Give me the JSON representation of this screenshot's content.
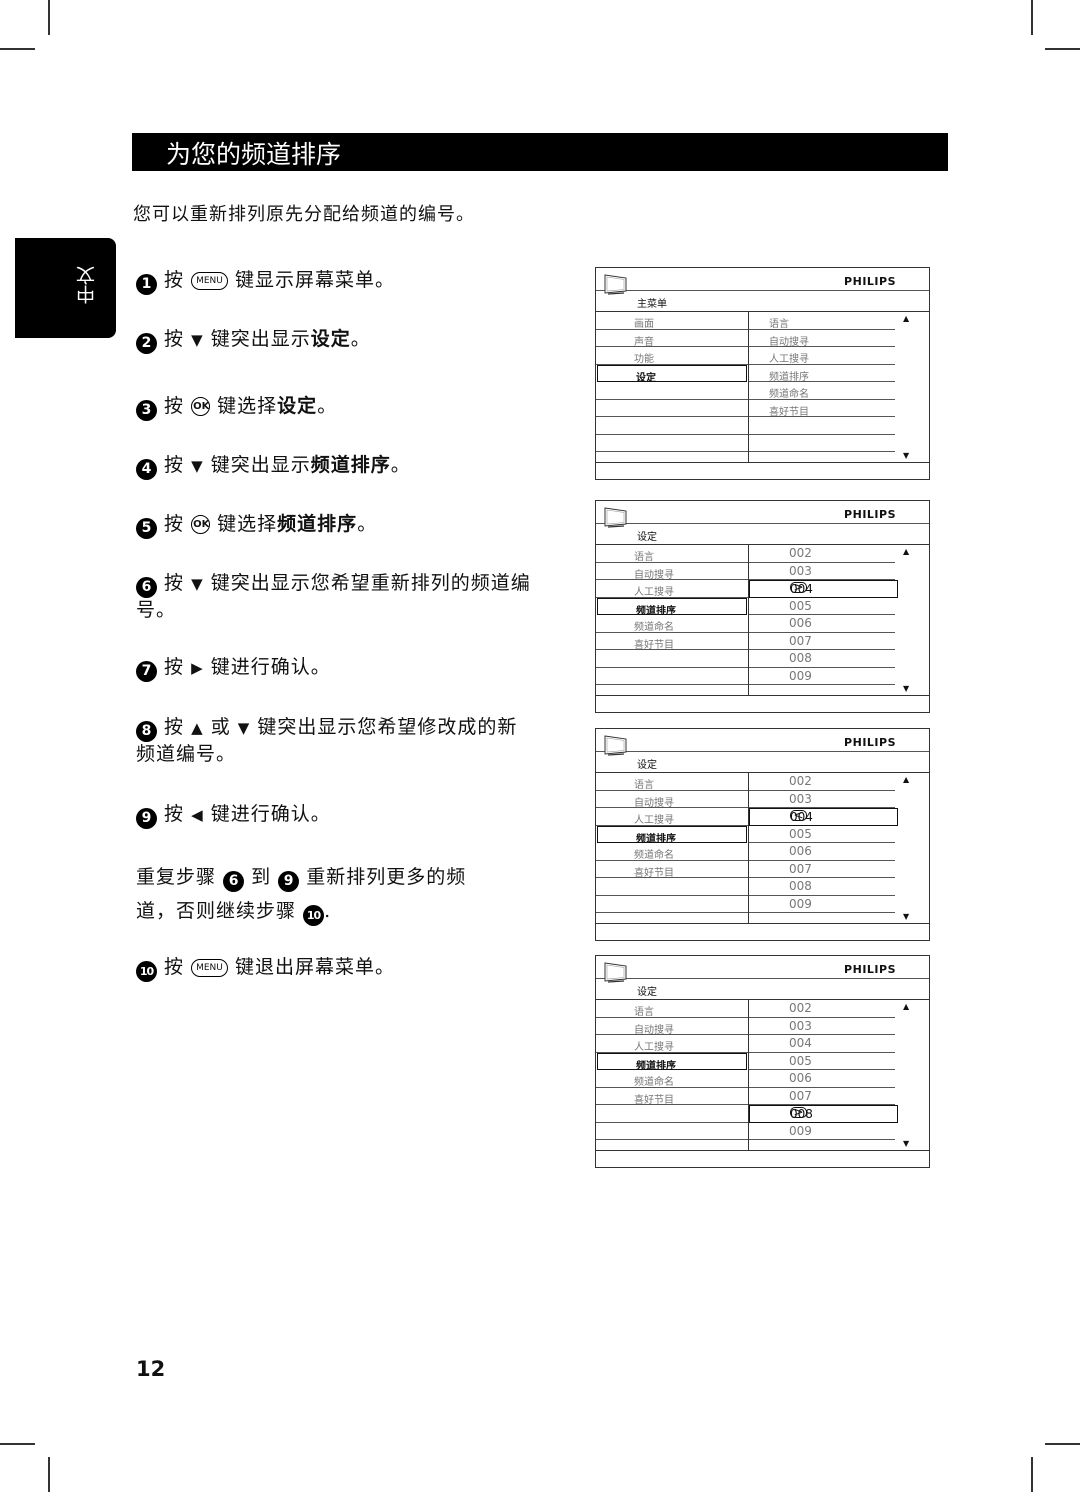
{
  "page": {
    "title": "为您的频道排序",
    "intro": "您可以重新排列原先分配给频道的编号。",
    "language_tab": "中文",
    "page_number": "12"
  },
  "steps": [
    {
      "num": "1",
      "pre": "按",
      "key": "MENU",
      "post": "键显示屏幕菜单。"
    },
    {
      "num": "2",
      "pre": "按",
      "arrow": "▼",
      "post": "键突出显示",
      "bold": "设定",
      "end": "。"
    },
    {
      "num": "3",
      "pre": "按",
      "key": "OK",
      "post": "键选择",
      "bold": "设定",
      "end": "。"
    },
    {
      "num": "4",
      "pre": "按",
      "arrow": "▼",
      "post": "键突出显示",
      "bold": "频道排序",
      "end": "。"
    },
    {
      "num": "5",
      "pre": "按",
      "key": "OK",
      "post": "键选择",
      "bold": "频道排序",
      "end": "。"
    },
    {
      "num": "6",
      "pre": "按",
      "arrow": "▼",
      "post": "键突出显示您希望重新排列的频道编号。"
    },
    {
      "num": "7",
      "pre": "按",
      "arrow": "▶",
      "post": "键进行确认。"
    },
    {
      "num": "8",
      "pre": "按",
      "arrow": "▲",
      "mid": "或",
      "arrow2": "▼",
      "post": "键突出显示您希望修改成的新频道编号。"
    },
    {
      "num": "9",
      "pre": "按",
      "arrow": "◀",
      "post": "键进行确认。"
    },
    {
      "num": "10",
      "pre": "按",
      "key": "MENU",
      "post": "键退出屏幕菜单。"
    }
  ],
  "repeat": {
    "a": "重复步骤",
    "n1": "6",
    "b": "到",
    "n2": "9",
    "c": "重新排列更多的频道，否则继续步骤",
    "n3": "10",
    "d": "."
  },
  "tv_screens": [
    {
      "brand": "PHILIPS",
      "menu_title": "主菜单",
      "left": [
        "画面",
        "声音",
        "功能",
        "设定",
        "",
        "",
        "",
        ""
      ],
      "left_selected": 3,
      "right": [
        "语言",
        "自动搜寻",
        "人工搜寻",
        "频道排序",
        "频道命名",
        "喜好节目",
        "",
        ""
      ],
      "right_highlight": -1,
      "button": ""
    },
    {
      "brand": "PHILIPS",
      "menu_title": "设定",
      "left": [
        "语言",
        "自动搜寻",
        "人工搜寻",
        "频道排序",
        "频道命名",
        "喜好节目",
        "",
        ""
      ],
      "left_selected": 3,
      "right": [
        "002",
        "003",
        "004",
        "005",
        "006",
        "007",
        "008",
        "009"
      ],
      "right_highlight": 2,
      "button": ">"
    },
    {
      "brand": "PHILIPS",
      "menu_title": "设定",
      "left": [
        "语言",
        "自动搜寻",
        "人工搜寻",
        "频道排序",
        "频道命名",
        "喜好节目",
        "",
        ""
      ],
      "left_selected": 3,
      "right": [
        "002",
        "003",
        "004",
        "005",
        "006",
        "007",
        "008",
        "009"
      ],
      "right_highlight": 2,
      "button": "<"
    },
    {
      "brand": "PHILIPS",
      "menu_title": "设定",
      "left": [
        "语言",
        "自动搜寻",
        "人工搜寻",
        "频道排序",
        "频道命名",
        "喜好节目",
        "",
        ""
      ],
      "left_selected": 3,
      "right": [
        "002",
        "003",
        "004",
        "005",
        "006",
        "007",
        "008",
        "009"
      ],
      "right_highlight": 6,
      "button": ">"
    }
  ],
  "icons": {
    "scroll_up": "▲",
    "scroll_down": "▼"
  }
}
